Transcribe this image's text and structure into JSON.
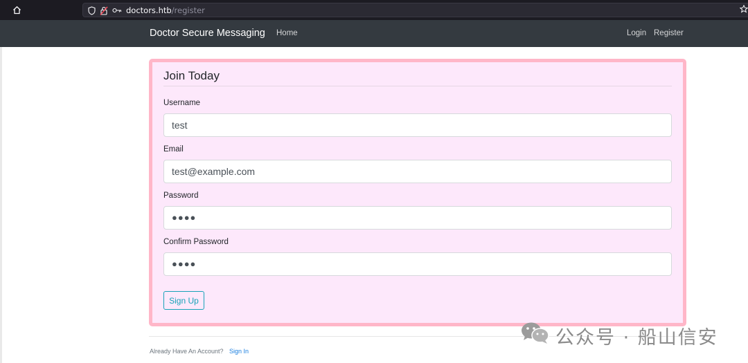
{
  "browser": {
    "url_host": "doctors.htb",
    "url_path": "/register"
  },
  "navbar": {
    "brand": "Doctor Secure Messaging",
    "home": "Home",
    "login": "Login",
    "register": "Register"
  },
  "form": {
    "legend": "Join Today",
    "username_label": "Username",
    "username_value": "test",
    "email_label": "Email",
    "email_value": "test@example.com",
    "password_label": "Password",
    "password_mask": "●●●●",
    "confirm_label": "Confirm Password",
    "confirm_mask": "●●●●",
    "submit": "Sign Up"
  },
  "footer": {
    "prompt": "Already Have An Account?",
    "signin": "Sign In"
  },
  "watermark": {
    "text": "公众号 · 船山信安"
  },
  "colors": {
    "navbar_bg": "#343a40",
    "card_bg": "#fde8fb",
    "highlight_border": "#ffb6c8",
    "button_accent": "#17a2b8",
    "link": "#1b7fe0"
  }
}
